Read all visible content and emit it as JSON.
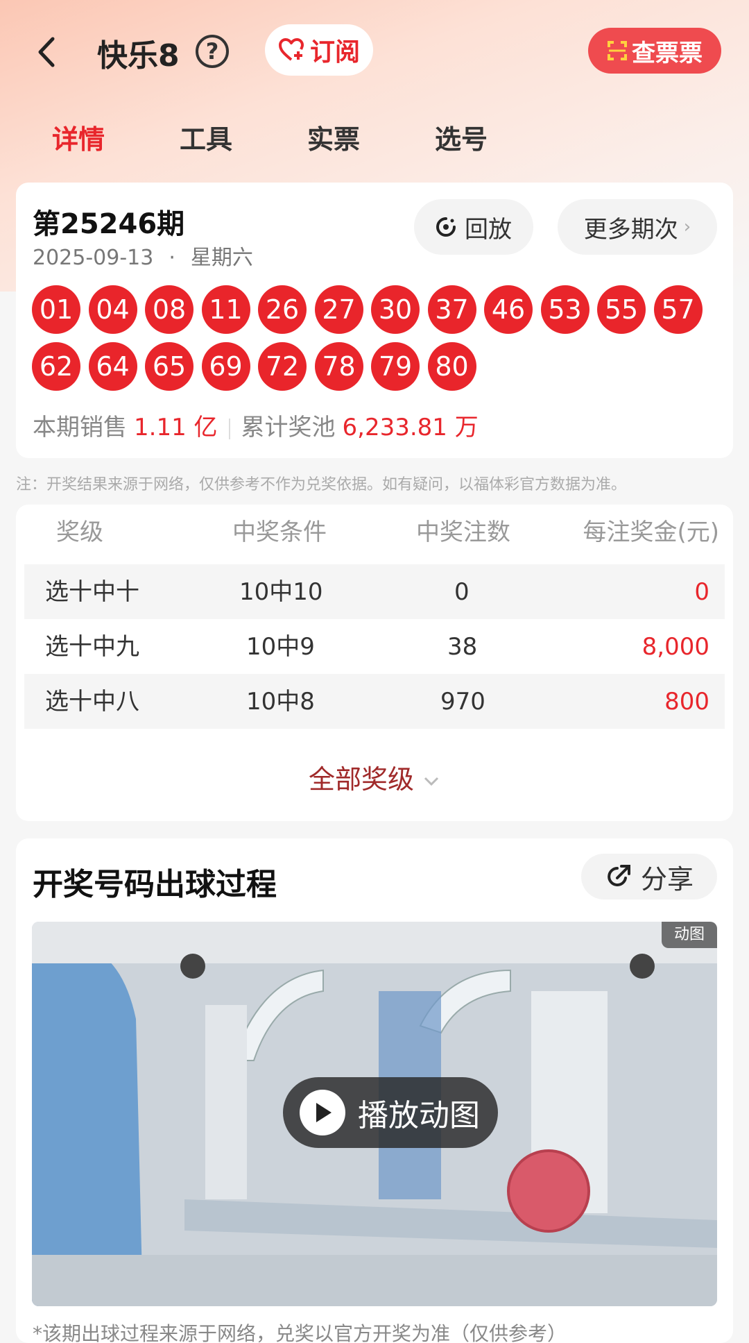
{
  "header": {
    "title": "快乐8",
    "help_glyph": "?",
    "subscribe_label": "订阅",
    "ticket_label": "查票票"
  },
  "tabs": [
    {
      "label": "详情",
      "active": true
    },
    {
      "label": "工具",
      "active": false
    },
    {
      "label": "实票",
      "active": false
    },
    {
      "label": "选号",
      "active": false
    }
  ],
  "draw": {
    "issue": "第25246期",
    "date": "2025-09-13",
    "dot": "·",
    "weekday": "星期六",
    "replay_label": "回放",
    "more_label": "更多期次",
    "numbers": [
      "01",
      "04",
      "08",
      "11",
      "26",
      "27",
      "30",
      "37",
      "46",
      "53",
      "55",
      "57",
      "62",
      "64",
      "65",
      "69",
      "72",
      "78",
      "79",
      "80"
    ],
    "sales_label": "本期销售",
    "sales_value": "1.11 亿",
    "pool_label": "累计奖池",
    "pool_value": "6,233.81 万"
  },
  "note": "注：开奖结果来源于网络，仅供参考不作为兑奖依据。如有疑问，以福体彩官方数据为准。",
  "prize_table": {
    "headers": [
      "奖级",
      "中奖条件",
      "中奖注数",
      "每注奖金(元)"
    ],
    "rows": [
      {
        "level": "选十中十",
        "condition": "10中10",
        "count": "0",
        "amount": "0"
      },
      {
        "level": "选十中九",
        "condition": "10中9",
        "count": "38",
        "amount": "8,000"
      },
      {
        "level": "选十中八",
        "condition": "10中8",
        "count": "970",
        "amount": "800"
      }
    ],
    "all_levels_label": "全部奖级"
  },
  "process": {
    "title": "开奖号码出球过程",
    "share_label": "分享",
    "gif_badge": "动图",
    "play_label": "播放动图",
    "disclaimer": "*该期出球过程来源于网络，兑奖以官方开奖为准（仅供参考）"
  },
  "colors": {
    "accent": "#e8262c",
    "ball": "#e9252b",
    "ticket_button": "#ef4b4f"
  }
}
